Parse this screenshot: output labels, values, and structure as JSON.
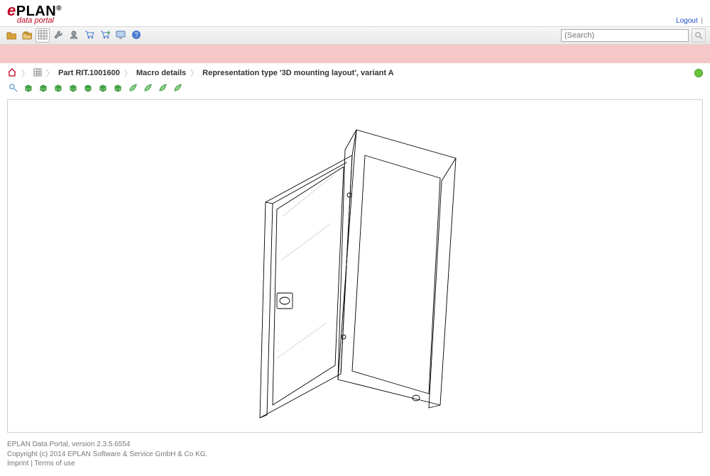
{
  "header": {
    "logo_main": "PLAN",
    "logo_reg": "®",
    "logo_sub": "data portal",
    "logout": "Logout"
  },
  "search": {
    "placeholder": "(Search)"
  },
  "toolbar_icons": [
    "folder-icon",
    "folder-copy-icon",
    "grid-icon",
    "wrench-icon",
    "head-icon",
    "cart-icon",
    "cart-down-icon",
    "monitor-icon",
    "help-icon"
  ],
  "breadcrumb": {
    "part_label": "Part RIT.1001600",
    "macro_label": "Macro details",
    "rep_label": "Representation type '3D mounting layout', variant A"
  },
  "viewer_toolbar_icons": [
    "zoom-fit-icon",
    "cube-iso-icon",
    "cube-front-icon",
    "cube-left-icon",
    "cube-top-icon",
    "cube-right-icon",
    "cube-back-icon",
    "cube-bottom-icon",
    "leaf-icon",
    "leaf-icon",
    "leaf-icon",
    "leaf-icon"
  ],
  "footer": {
    "line1": "EPLAN Data Portal, version 2.3.5.6554",
    "line2": "Copyright (c) 2014 EPLAN Software & Service GmbH & Co KG.",
    "imprint": "Imprint",
    "terms": "Terms of use"
  }
}
